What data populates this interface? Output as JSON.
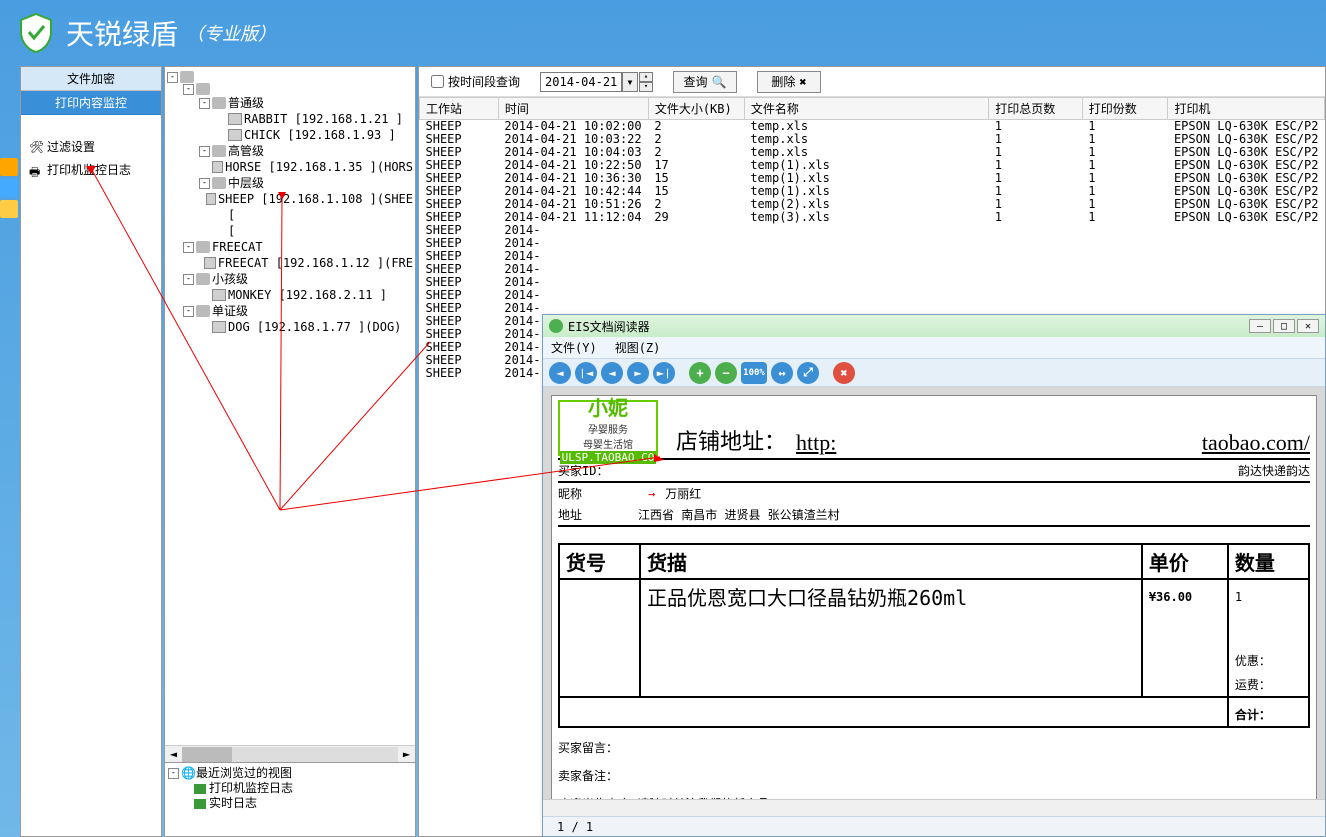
{
  "app": {
    "title": "天锐绿盾",
    "subtitle": "（专业版）"
  },
  "left_panel": {
    "tab1": "文件加密",
    "tab2": "打印内容监控",
    "link_filter": "过滤设置",
    "link_log": "打印机监控日志"
  },
  "tree": {
    "rows": [
      {
        "indent": 0,
        "exp": "-",
        "icon": "group",
        "text": ""
      },
      {
        "indent": 1,
        "exp": "-",
        "icon": "group",
        "text": ""
      },
      {
        "indent": 2,
        "exp": "-",
        "icon": "group",
        "text": "普通级"
      },
      {
        "indent": 3,
        "exp": "",
        "icon": "pc",
        "text": "RABBIT  [192.168.1.21  ]"
      },
      {
        "indent": 3,
        "exp": "",
        "icon": "pc",
        "text": "CHICK   [192.168.1.93  ]"
      },
      {
        "indent": 2,
        "exp": "-",
        "icon": "group",
        "text": "高管级"
      },
      {
        "indent": 3,
        "exp": "",
        "icon": "pc",
        "text": "HORSE   [192.168.1.35  ](HORS"
      },
      {
        "indent": 2,
        "exp": "-",
        "icon": "group",
        "text": "中层级"
      },
      {
        "indent": 3,
        "exp": "",
        "icon": "pc",
        "text": "SHEEP   [192.168.1.108 ](SHEE"
      },
      {
        "indent": 3,
        "exp": "",
        "icon": "",
        "text": "        ["
      },
      {
        "indent": 3,
        "exp": "",
        "icon": "",
        "text": "        ["
      },
      {
        "indent": 1,
        "exp": "-",
        "icon": "group",
        "text": "FREECAT"
      },
      {
        "indent": 2,
        "exp": "",
        "icon": "pc",
        "text": "FREECAT [192.168.1.12  ](FRE"
      },
      {
        "indent": 1,
        "exp": "-",
        "icon": "group",
        "text": "小孩级"
      },
      {
        "indent": 2,
        "exp": "",
        "icon": "pc",
        "text": "MONKEY  [192.168.2.11  ]"
      },
      {
        "indent": 1,
        "exp": "-",
        "icon": "group",
        "text": "单证级"
      },
      {
        "indent": 2,
        "exp": "",
        "icon": "pc",
        "text": "DOG     [192.168.1.77  ](DOG)"
      }
    ]
  },
  "recent": {
    "title": "最近浏览过的视图",
    "items": [
      "打印机监控日志",
      "实时日志"
    ]
  },
  "filter": {
    "chk_label": "按时间段查询",
    "date": "2014-04-21",
    "btn_query": "查询",
    "btn_delete": "删除"
  },
  "grid": {
    "cols": [
      "工作站",
      "时间",
      "文件大小(KB)",
      "文件名称",
      "打印总页数",
      "打印份数",
      "打印机"
    ],
    "rows": [
      [
        "SHEEP",
        "2014-04-21 10:02:00",
        "2",
        "temp.xls",
        "1",
        "1",
        "EPSON LQ-630K ESC/P2"
      ],
      [
        "SHEEP",
        "2014-04-21 10:03:22",
        "2",
        "temp.xls",
        "1",
        "1",
        "EPSON LQ-630K ESC/P2"
      ],
      [
        "SHEEP",
        "2014-04-21 10:04:03",
        "2",
        "temp.xls",
        "1",
        "1",
        "EPSON LQ-630K ESC/P2"
      ],
      [
        "SHEEP",
        "2014-04-21 10:22:50",
        "17",
        "temp(1).xls",
        "1",
        "1",
        "EPSON LQ-630K ESC/P2"
      ],
      [
        "SHEEP",
        "2014-04-21 10:36:30",
        "15",
        "temp(1).xls",
        "1",
        "1",
        "EPSON LQ-630K ESC/P2"
      ],
      [
        "SHEEP",
        "2014-04-21 10:42:44",
        "15",
        "temp(1).xls",
        "1",
        "1",
        "EPSON LQ-630K ESC/P2"
      ],
      [
        "SHEEP",
        "2014-04-21 10:51:26",
        "2",
        "temp(2).xls",
        "1",
        "1",
        "EPSON LQ-630K ESC/P2"
      ],
      [
        "SHEEP",
        "2014-04-21 11:12:04",
        "29",
        "temp(3).xls",
        "1",
        "1",
        "EPSON LQ-630K ESC/P2"
      ],
      [
        "SHEEP",
        "2014-",
        "",
        "",
        "",
        "",
        ""
      ],
      [
        "SHEEP",
        "2014-",
        "",
        "",
        "",
        "",
        ""
      ],
      [
        "SHEEP",
        "2014-",
        "",
        "",
        "",
        "",
        ""
      ],
      [
        "SHEEP",
        "2014-",
        "",
        "",
        "",
        "",
        ""
      ],
      [
        "SHEEP",
        "2014-",
        "",
        "",
        "",
        "",
        ""
      ],
      [
        "SHEEP",
        "2014-",
        "",
        "",
        "",
        "",
        ""
      ],
      [
        "SHEEP",
        "2014-",
        "",
        "",
        "",
        "",
        ""
      ],
      [
        "SHEEP",
        "2014-",
        "",
        "",
        "",
        "",
        ""
      ],
      [
        "SHEEP",
        "2014-",
        "",
        "",
        "",
        "",
        ""
      ],
      [
        "SHEEP",
        "2014-",
        "",
        "",
        "",
        "",
        ""
      ],
      [
        "SHEEP",
        "2014-",
        "",
        "",
        "",
        "",
        ""
      ],
      [
        "SHEEP",
        "2014-",
        "",
        "",
        "",
        "",
        ""
      ]
    ]
  },
  "viewer": {
    "title": "EIS文档阅读器",
    "menu_file": "文件(Y)",
    "menu_view": "视图(Z)",
    "page_status": "1 / 1",
    "shop": {
      "name": "小妮",
      "sub1": "孕婴服务",
      "sub2": "母婴生活馆",
      "url_tag": "ULSP.TAOBAO.CO"
    },
    "shop_addr_label": "店铺地址：",
    "shop_addr_http": "http:",
    "shop_addr_site": "taobao.com/",
    "buyer_id_label": "买家ID：",
    "courier": "韵达快递韵达",
    "nick_label": "昵称",
    "nick_value": "万丽红",
    "addr_label": "地址",
    "addr_value": "江西省  南昌市  进贤县  张公镇渣兰村",
    "item_cols": [
      "货号",
      "货描",
      "单价",
      "数量"
    ],
    "item_desc": "正品优恩宽口大口径晶钻奶瓶260ml",
    "item_price": "¥36.00",
    "item_qty": "1",
    "discount_label": "优惠：",
    "ship_label": "运费：",
    "total_label": "合计：",
    "note1": "买家留言：",
    "note2": "卖家备注：",
    "note3": "欢迎光临本店,请随时关注我们的新产品。"
  }
}
